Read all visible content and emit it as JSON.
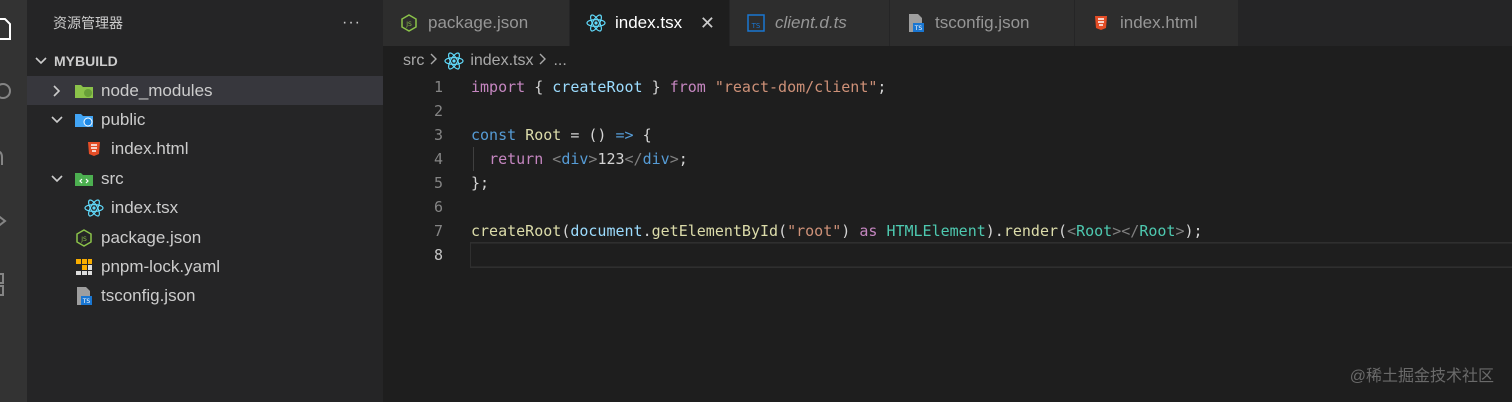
{
  "activity_bar": {
    "icons": [
      "files-icon",
      "search-icon",
      "source-control-icon",
      "run-debug-icon",
      "extensions-icon"
    ]
  },
  "sidebar": {
    "title": "资源管理器",
    "more_label": "···",
    "project": "MYBUILD",
    "tree": [
      {
        "label": "node_modules",
        "icon": "folder-node-icon",
        "expanded": false,
        "selected": true
      },
      {
        "label": "public",
        "icon": "folder-public-icon",
        "expanded": true
      },
      {
        "label": "index.html",
        "icon": "html5-icon"
      },
      {
        "label": "src",
        "icon": "folder-src-icon",
        "expanded": true
      },
      {
        "label": "index.tsx",
        "icon": "react-icon"
      },
      {
        "label": "package.json",
        "icon": "nodejs-icon"
      },
      {
        "label": "pnpm-lock.yaml",
        "icon": "pnpm-icon"
      },
      {
        "label": "tsconfig.json",
        "icon": "tsconfig-icon"
      }
    ]
  },
  "tabs": [
    {
      "label": "package.json",
      "icon": "nodejs-icon",
      "active": false
    },
    {
      "label": "index.tsx",
      "icon": "react-icon",
      "active": true,
      "close": "✕"
    },
    {
      "label": "client.d.ts",
      "icon": "typescript-def-icon",
      "active": false,
      "italic": true
    },
    {
      "label": "tsconfig.json",
      "icon": "tsconfig-icon",
      "active": false
    },
    {
      "label": "index.html",
      "icon": "html5-icon",
      "active": false
    }
  ],
  "breadcrumb": {
    "folder": "src",
    "file": "index.tsx",
    "more": "..."
  },
  "editor": {
    "line_numbers": [
      "1",
      "2",
      "3",
      "4",
      "5",
      "6",
      "7",
      "8"
    ],
    "current_line": 8,
    "colors": {
      "keyword": "#c586c0",
      "storage": "#569cd6",
      "function": "#dcdcaa",
      "variable": "#9cdcfe",
      "string": "#ce9178",
      "type": "#4ec9b0",
      "tag_bracket": "#808080",
      "plain": "#d4d4d4",
      "number": "#b5cea8"
    }
  },
  "code": {
    "l1": {
      "import": "import",
      "ob": " { ",
      "fn": "createRoot",
      "cb": " } ",
      "from": "from",
      "sp": " ",
      "str": "\"react-dom/client\"",
      "semi": ";"
    },
    "l3": {
      "const": "const",
      "sp1": " ",
      "name": "Root",
      "eq": " = () ",
      "arrow": "=>",
      "brace": " {"
    },
    "l4": {
      "indent": "  ",
      "ret": "return",
      "sp": " ",
      "lt1": "<",
      "tag1": "div",
      "gt1": ">",
      "text": "123",
      "lt2": "</",
      "tag2": "div",
      "gt2": ">",
      "semi": ";"
    },
    "l5": {
      "close": "};"
    },
    "l7": {
      "fn": "createRoot",
      "p1": "(",
      "obj": "document",
      "dot": ".",
      "method": "getElementById",
      "p2": "(",
      "str": "\"root\"",
      "p3": ") ",
      "as": "as",
      "sp": " ",
      "type": "HTMLElement",
      "p4": ").",
      "render": "render",
      "p5": "(",
      "lt1": "<",
      "tag1": "Root",
      "gt1": ">",
      "lt2": "</",
      "tag2": "Root",
      "gt2": ">",
      "p6": ");"
    }
  },
  "watermark": "@稀土掘金技术社区"
}
